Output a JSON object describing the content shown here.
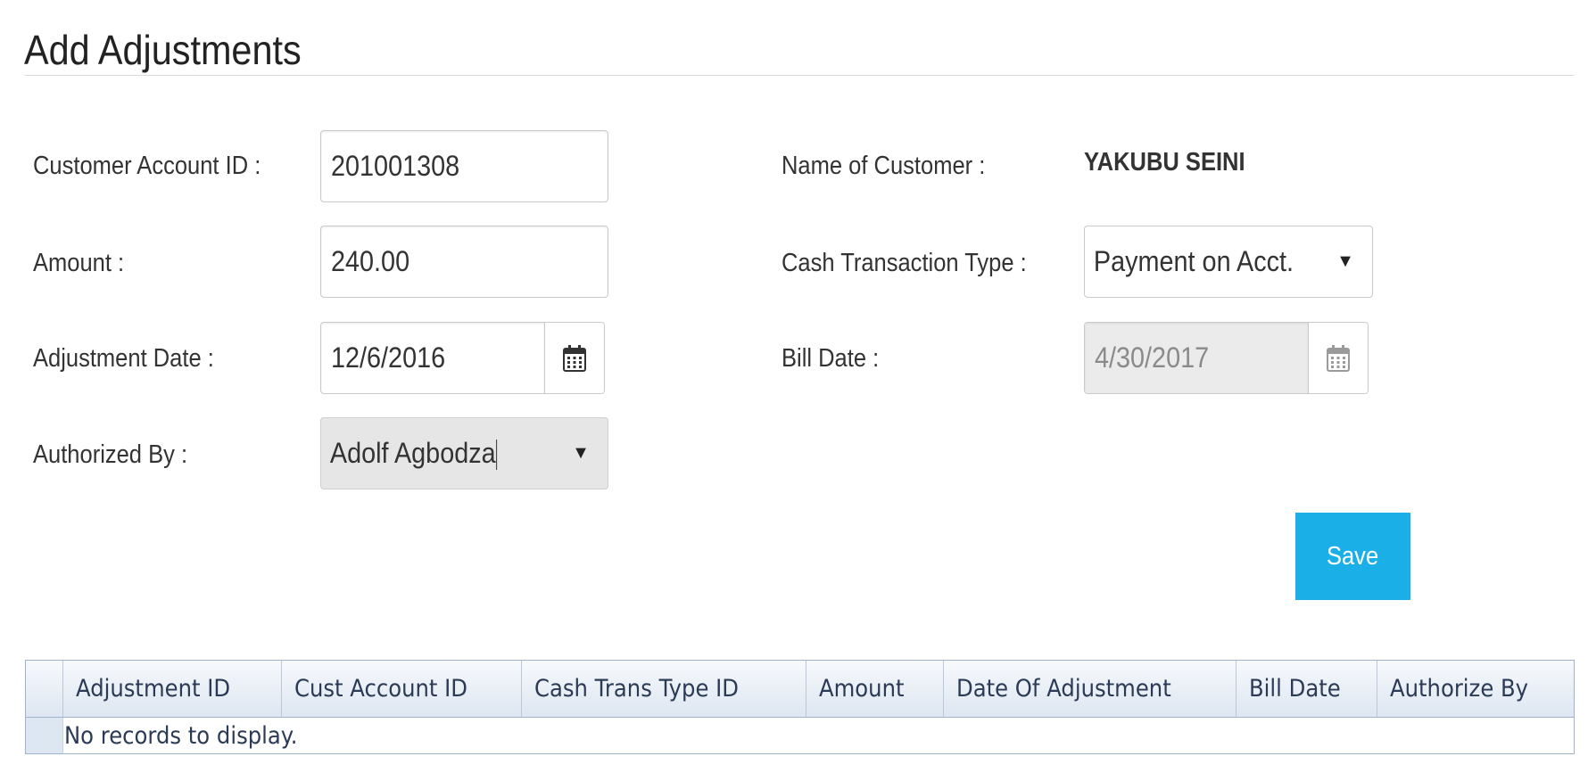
{
  "page": {
    "title": "Add Adjustments"
  },
  "form": {
    "customer_account_id": {
      "label": "Customer Account ID :",
      "value": "201001308"
    },
    "amount": {
      "label": "Amount :",
      "value": "240.00"
    },
    "adjustment_date": {
      "label": "Adjustment Date :",
      "value": "12/6/2016",
      "icon": "calendar-icon"
    },
    "authorized_by": {
      "label": "Authorized By :",
      "selected": "Adolf Agbodza",
      "icon": "dropdown-arrow-icon"
    },
    "name_of_customer": {
      "label": "Name of Customer :",
      "value": "YAKUBU SEINI"
    },
    "cash_transaction_type": {
      "label": "Cash Transaction Type :",
      "selected": "Payment on Acct.",
      "icon": "dropdown-arrow-icon"
    },
    "bill_date": {
      "label": "Bill Date :",
      "value": "4/30/2017",
      "disabled": true,
      "icon": "calendar-icon"
    },
    "save_label": "Save"
  },
  "grid": {
    "columns": [
      "Adjustment ID",
      "Cust Account ID",
      "Cash Trans Type ID",
      "Amount",
      "Date Of Adjustment",
      "Bill Date",
      "Authorize By"
    ],
    "rows": [],
    "empty_message": "No records to display."
  },
  "colors": {
    "save_button": "#1aafe6",
    "grid_border": "#9fb3cc",
    "grid_header_text": "#2b3a55",
    "disabled_field_bg": "#ebebeb"
  }
}
